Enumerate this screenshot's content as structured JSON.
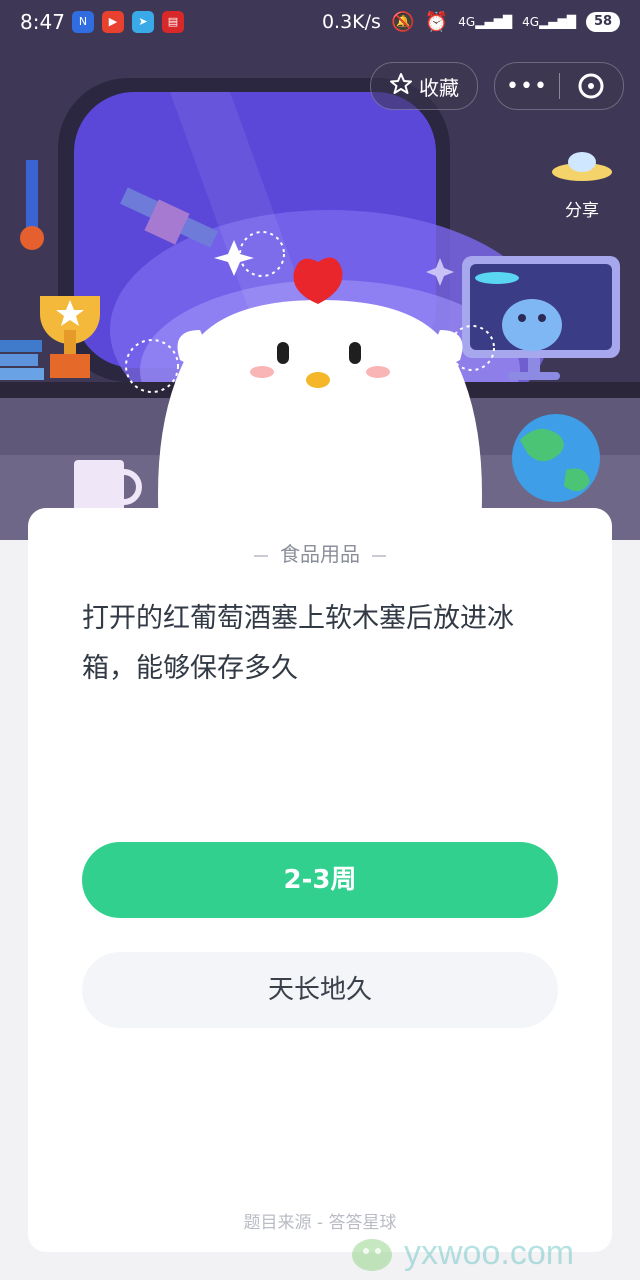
{
  "status_bar": {
    "time": "8:47",
    "network_speed": "0.3K/s",
    "signal1": "4G",
    "signal2": "4G",
    "battery": "58",
    "app_icons": [
      "notification-app-n-icon",
      "notification-app-video-icon",
      "notification-app-telegram-icon",
      "notification-app-news-icon"
    ]
  },
  "header": {
    "favorite_label": "收藏",
    "more_label": "•••",
    "share_label": "分享"
  },
  "card": {
    "category": "食品用品",
    "question": "打开的红葡萄酒塞上软木塞后放进冰箱，能够保存多久",
    "options": [
      "2-3周",
      "天长地久"
    ],
    "source": "题目来源 - 答答星球"
  },
  "watermark": {
    "text": "yxwoo.com"
  },
  "colors": {
    "accent_green": "#31d08f",
    "scene_bg": "#3a3450",
    "option_bg": "#f3f5f8"
  }
}
